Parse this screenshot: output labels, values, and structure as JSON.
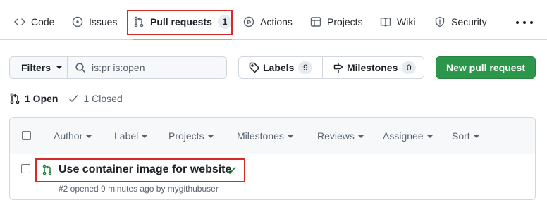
{
  "nav": {
    "tabs": [
      {
        "label": "Code",
        "icon": "code-icon"
      },
      {
        "label": "Issues",
        "icon": "issue-opened-icon"
      },
      {
        "label": "Pull requests",
        "icon": "git-pull-request-icon",
        "counter": "1",
        "selected": true
      },
      {
        "label": "Actions",
        "icon": "play-icon"
      },
      {
        "label": "Projects",
        "icon": "table-icon"
      },
      {
        "label": "Wiki",
        "icon": "book-icon"
      },
      {
        "label": "Security",
        "icon": "shield-icon"
      }
    ],
    "more_icon": "kebab-horizontal-icon"
  },
  "toolbar": {
    "filters_label": "Filters",
    "search_value": "is:pr is:open",
    "labels_label": "Labels",
    "labels_count": "9",
    "milestones_label": "Milestones",
    "milestones_count": "0",
    "new_pr_label": "New pull request"
  },
  "states": {
    "open_label": "1 Open",
    "closed_label": "1 Closed"
  },
  "list_header": {
    "filters": [
      "Author",
      "Label",
      "Projects",
      "Milestones",
      "Reviews",
      "Assignee",
      "Sort"
    ]
  },
  "pull_requests": [
    {
      "title": "Use container image for website",
      "meta": "#2 opened 9 minutes ago by mygithubuser",
      "status": "success"
    }
  ],
  "colors": {
    "accent_green": "#2c974b",
    "highlight_red": "#d62a2a",
    "selected_underline": "#fd8c73",
    "open_green": "#1a7f37"
  }
}
